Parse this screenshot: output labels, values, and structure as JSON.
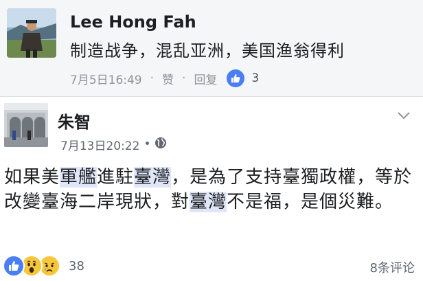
{
  "comment": {
    "author": "Lee Hong Fah",
    "text": "制造战争，混乱亚洲，美国渔翁得利",
    "timestamp": "7月5日16:49",
    "like_action": "赞",
    "reply_action": "回复",
    "like_count": "3",
    "separator": "·"
  },
  "post": {
    "author": "朱智",
    "timestamp": "7月13日20:22",
    "separator": "•",
    "privacy_icon": "globe-icon",
    "body": [
      {
        "text": "如果美",
        "highlight": false
      },
      {
        "text": "軍艦",
        "highlight": true
      },
      {
        "text": "進駐",
        "highlight": false
      },
      {
        "text": "臺灣",
        "highlight": true
      },
      {
        "text": "，是為了支持臺獨政權，等於改變臺海二岸現狀，對",
        "highlight": false
      },
      {
        "text": "臺灣",
        "highlight": true
      },
      {
        "text": "不是福，是個災難。",
        "highlight": false
      }
    ],
    "reactions": [
      "like-icon",
      "wow-icon",
      "sad-icon"
    ],
    "reaction_count": "38",
    "comment_count": "8条评论"
  },
  "colors": {
    "like_blue": "#4a7ef5",
    "emoji_yellow": "#f7c73b",
    "highlight": "#dfe6f7",
    "meta_gray": "#90949c"
  }
}
